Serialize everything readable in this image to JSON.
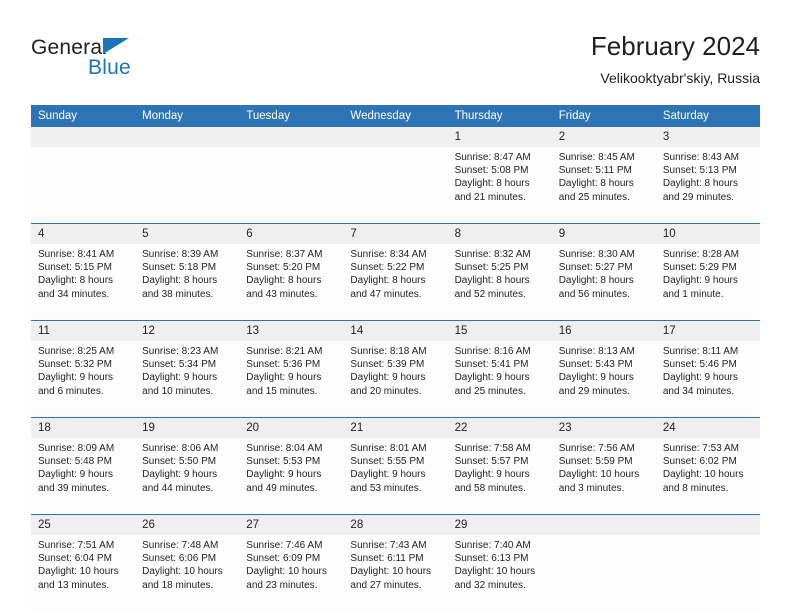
{
  "brand": {
    "name_top": "General",
    "name_bottom": "Blue",
    "accent_color": "#1b75bb"
  },
  "header": {
    "title": "February 2024",
    "subtitle": "Velikooktyabr'skiy, Russia"
  },
  "theme": {
    "header_blue": "#2d74b5",
    "daynum_gray": "#efefef",
    "text": "#231f20"
  },
  "weekday_headers": [
    "Sunday",
    "Monday",
    "Tuesday",
    "Wednesday",
    "Thursday",
    "Friday",
    "Saturday"
  ],
  "weeks": [
    [
      {
        "day": "",
        "sunrise": "",
        "sunset": "",
        "daylight1": "",
        "daylight2": ""
      },
      {
        "day": "",
        "sunrise": "",
        "sunset": "",
        "daylight1": "",
        "daylight2": ""
      },
      {
        "day": "",
        "sunrise": "",
        "sunset": "",
        "daylight1": "",
        "daylight2": ""
      },
      {
        "day": "",
        "sunrise": "",
        "sunset": "",
        "daylight1": "",
        "daylight2": ""
      },
      {
        "day": "1",
        "sunrise": "Sunrise: 8:47 AM",
        "sunset": "Sunset: 5:08 PM",
        "daylight1": "Daylight: 8 hours",
        "daylight2": "and 21 minutes."
      },
      {
        "day": "2",
        "sunrise": "Sunrise: 8:45 AM",
        "sunset": "Sunset: 5:11 PM",
        "daylight1": "Daylight: 8 hours",
        "daylight2": "and 25 minutes."
      },
      {
        "day": "3",
        "sunrise": "Sunrise: 8:43 AM",
        "sunset": "Sunset: 5:13 PM",
        "daylight1": "Daylight: 8 hours",
        "daylight2": "and 29 minutes."
      }
    ],
    [
      {
        "day": "4",
        "sunrise": "Sunrise: 8:41 AM",
        "sunset": "Sunset: 5:15 PM",
        "daylight1": "Daylight: 8 hours",
        "daylight2": "and 34 minutes."
      },
      {
        "day": "5",
        "sunrise": "Sunrise: 8:39 AM",
        "sunset": "Sunset: 5:18 PM",
        "daylight1": "Daylight: 8 hours",
        "daylight2": "and 38 minutes."
      },
      {
        "day": "6",
        "sunrise": "Sunrise: 8:37 AM",
        "sunset": "Sunset: 5:20 PM",
        "daylight1": "Daylight: 8 hours",
        "daylight2": "and 43 minutes."
      },
      {
        "day": "7",
        "sunrise": "Sunrise: 8:34 AM",
        "sunset": "Sunset: 5:22 PM",
        "daylight1": "Daylight: 8 hours",
        "daylight2": "and 47 minutes."
      },
      {
        "day": "8",
        "sunrise": "Sunrise: 8:32 AM",
        "sunset": "Sunset: 5:25 PM",
        "daylight1": "Daylight: 8 hours",
        "daylight2": "and 52 minutes."
      },
      {
        "day": "9",
        "sunrise": "Sunrise: 8:30 AM",
        "sunset": "Sunset: 5:27 PM",
        "daylight1": "Daylight: 8 hours",
        "daylight2": "and 56 minutes."
      },
      {
        "day": "10",
        "sunrise": "Sunrise: 8:28 AM",
        "sunset": "Sunset: 5:29 PM",
        "daylight1": "Daylight: 9 hours",
        "daylight2": "and 1 minute."
      }
    ],
    [
      {
        "day": "11",
        "sunrise": "Sunrise: 8:25 AM",
        "sunset": "Sunset: 5:32 PM",
        "daylight1": "Daylight: 9 hours",
        "daylight2": "and 6 minutes."
      },
      {
        "day": "12",
        "sunrise": "Sunrise: 8:23 AM",
        "sunset": "Sunset: 5:34 PM",
        "daylight1": "Daylight: 9 hours",
        "daylight2": "and 10 minutes."
      },
      {
        "day": "13",
        "sunrise": "Sunrise: 8:21 AM",
        "sunset": "Sunset: 5:36 PM",
        "daylight1": "Daylight: 9 hours",
        "daylight2": "and 15 minutes."
      },
      {
        "day": "14",
        "sunrise": "Sunrise: 8:18 AM",
        "sunset": "Sunset: 5:39 PM",
        "daylight1": "Daylight: 9 hours",
        "daylight2": "and 20 minutes."
      },
      {
        "day": "15",
        "sunrise": "Sunrise: 8:16 AM",
        "sunset": "Sunset: 5:41 PM",
        "daylight1": "Daylight: 9 hours",
        "daylight2": "and 25 minutes."
      },
      {
        "day": "16",
        "sunrise": "Sunrise: 8:13 AM",
        "sunset": "Sunset: 5:43 PM",
        "daylight1": "Daylight: 9 hours",
        "daylight2": "and 29 minutes."
      },
      {
        "day": "17",
        "sunrise": "Sunrise: 8:11 AM",
        "sunset": "Sunset: 5:46 PM",
        "daylight1": "Daylight: 9 hours",
        "daylight2": "and 34 minutes."
      }
    ],
    [
      {
        "day": "18",
        "sunrise": "Sunrise: 8:09 AM",
        "sunset": "Sunset: 5:48 PM",
        "daylight1": "Daylight: 9 hours",
        "daylight2": "and 39 minutes."
      },
      {
        "day": "19",
        "sunrise": "Sunrise: 8:06 AM",
        "sunset": "Sunset: 5:50 PM",
        "daylight1": "Daylight: 9 hours",
        "daylight2": "and 44 minutes."
      },
      {
        "day": "20",
        "sunrise": "Sunrise: 8:04 AM",
        "sunset": "Sunset: 5:53 PM",
        "daylight1": "Daylight: 9 hours",
        "daylight2": "and 49 minutes."
      },
      {
        "day": "21",
        "sunrise": "Sunrise: 8:01 AM",
        "sunset": "Sunset: 5:55 PM",
        "daylight1": "Daylight: 9 hours",
        "daylight2": "and 53 minutes."
      },
      {
        "day": "22",
        "sunrise": "Sunrise: 7:58 AM",
        "sunset": "Sunset: 5:57 PM",
        "daylight1": "Daylight: 9 hours",
        "daylight2": "and 58 minutes."
      },
      {
        "day": "23",
        "sunrise": "Sunrise: 7:56 AM",
        "sunset": "Sunset: 5:59 PM",
        "daylight1": "Daylight: 10 hours",
        "daylight2": "and 3 minutes."
      },
      {
        "day": "24",
        "sunrise": "Sunrise: 7:53 AM",
        "sunset": "Sunset: 6:02 PM",
        "daylight1": "Daylight: 10 hours",
        "daylight2": "and 8 minutes."
      }
    ],
    [
      {
        "day": "25",
        "sunrise": "Sunrise: 7:51 AM",
        "sunset": "Sunset: 6:04 PM",
        "daylight1": "Daylight: 10 hours",
        "daylight2": "and 13 minutes."
      },
      {
        "day": "26",
        "sunrise": "Sunrise: 7:48 AM",
        "sunset": "Sunset: 6:06 PM",
        "daylight1": "Daylight: 10 hours",
        "daylight2": "and 18 minutes."
      },
      {
        "day": "27",
        "sunrise": "Sunrise: 7:46 AM",
        "sunset": "Sunset: 6:09 PM",
        "daylight1": "Daylight: 10 hours",
        "daylight2": "and 23 minutes."
      },
      {
        "day": "28",
        "sunrise": "Sunrise: 7:43 AM",
        "sunset": "Sunset: 6:11 PM",
        "daylight1": "Daylight: 10 hours",
        "daylight2": "and 27 minutes."
      },
      {
        "day": "29",
        "sunrise": "Sunrise: 7:40 AM",
        "sunset": "Sunset: 6:13 PM",
        "daylight1": "Daylight: 10 hours",
        "daylight2": "and 32 minutes."
      },
      {
        "day": "",
        "sunrise": "",
        "sunset": "",
        "daylight1": "",
        "daylight2": ""
      },
      {
        "day": "",
        "sunrise": "",
        "sunset": "",
        "daylight1": "",
        "daylight2": ""
      }
    ]
  ]
}
